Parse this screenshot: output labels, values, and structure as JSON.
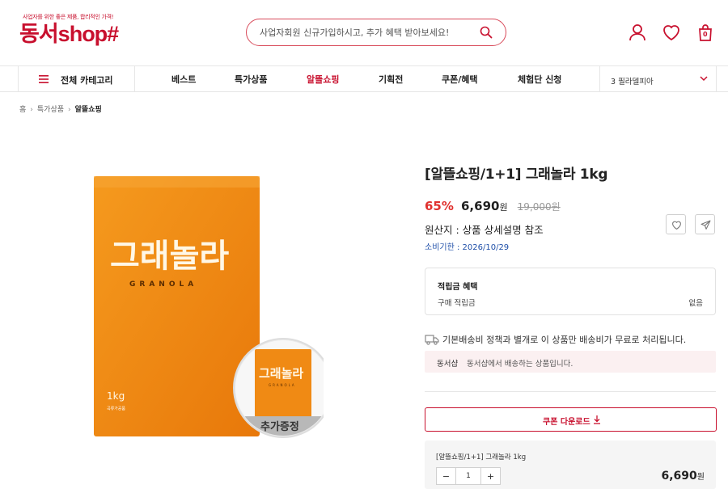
{
  "header": {
    "tagline": "사업자를 위한 좋은 제품, 합리적인 가격!",
    "brand": "동서shop#",
    "search_placeholder": "사업자회원 신규가입하시고, 추가 혜택 받아보세요!",
    "cart_count": "0"
  },
  "nav": {
    "all_categories": "전체 카테고리",
    "items": [
      "베스트",
      "특가상품",
      "알뜰쇼핑",
      "기획전",
      "쿠폰/혜택",
      "체험단 신청"
    ],
    "active_index": 2,
    "region": "3  필라델피아"
  },
  "breadcrumb": {
    "items": [
      "홈",
      "특가상품",
      "알뜰쇼핑"
    ]
  },
  "product": {
    "package_title": "그래놀라",
    "package_subtitle": "GRANOLA",
    "package_weight": "1kg",
    "package_small_text": "곡류가공품",
    "bonus_label": "추가증정",
    "title": "[알뜰쇼핑/1+1] 그래놀라 1kg",
    "discount": "65%",
    "price": "6,690",
    "price_unit": "원",
    "original_price": "19,000",
    "original_unit": "원",
    "origin": "원산지 : 상품 상세설명 참조",
    "expiry": "소비기한 : 2026/10/29"
  },
  "points": {
    "title": "적립금 혜택",
    "label": "구매 적립금",
    "value": "없음"
  },
  "shipping": {
    "notice": "기본배송비 정책과 별개로 이 상품만 배송비가 무료로 처리됩니다.",
    "seller": "동서샵",
    "seller_desc": "동서샵에서 배송하는 상품입니다."
  },
  "coupon": {
    "label": "쿠폰 다운로드"
  },
  "option": {
    "name": "[알뜰쇼핑/1+1] 그래놀라 1kg",
    "minus": "−",
    "quantity": "1",
    "plus": "+",
    "price": "6,690",
    "price_unit": "원"
  },
  "colors": {
    "brand": "#c8102e",
    "discount": "#e0312e",
    "package": "#f28a12"
  }
}
